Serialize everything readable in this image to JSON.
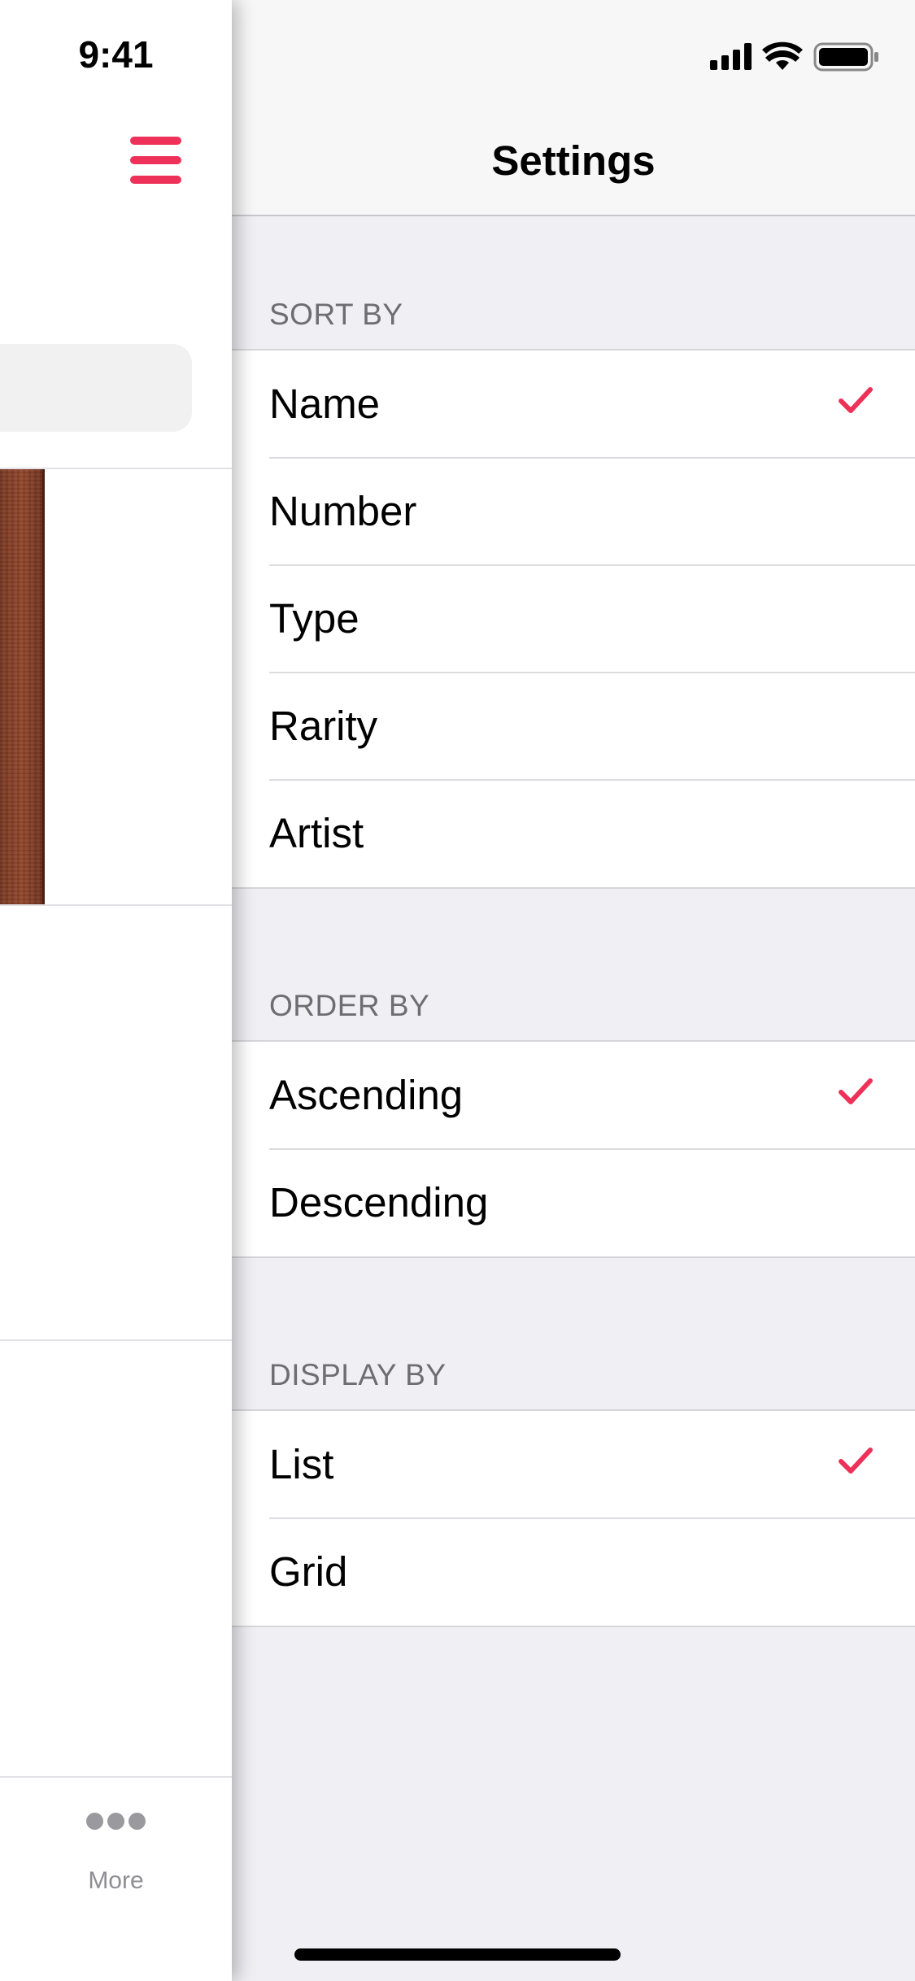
{
  "status_bar": {
    "time": "9:41"
  },
  "left_panel": {
    "more_label": "More"
  },
  "settings": {
    "title": "Settings",
    "accent_color": "#ee3158",
    "sections": [
      {
        "header": "SORT BY",
        "items": [
          {
            "label": "Name",
            "selected": true
          },
          {
            "label": "Number",
            "selected": false
          },
          {
            "label": "Type",
            "selected": false
          },
          {
            "label": "Rarity",
            "selected": false
          },
          {
            "label": "Artist",
            "selected": false
          }
        ]
      },
      {
        "header": "ORDER BY",
        "items": [
          {
            "label": "Ascending",
            "selected": true
          },
          {
            "label": "Descending",
            "selected": false
          }
        ]
      },
      {
        "header": "DISPLAY BY",
        "items": [
          {
            "label": "List",
            "selected": true
          },
          {
            "label": "Grid",
            "selected": false
          }
        ]
      }
    ]
  }
}
